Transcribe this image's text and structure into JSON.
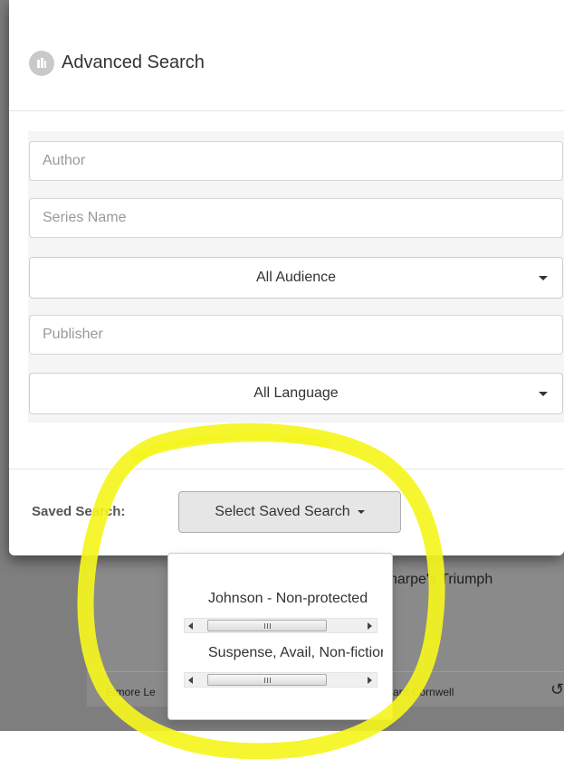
{
  "background": {
    "card_title_fragment": "harpe's Triumph",
    "author_left_fragment": "Elmore Le",
    "author_right_fragment": "ard Cornwell",
    "share_icon": "share-icon"
  },
  "modal": {
    "title": "Advanced Search",
    "logo_icon": "library-logo-icon",
    "fields": {
      "author_placeholder": "Author",
      "series_placeholder": "Series Name",
      "audience_selected": "All Audience",
      "publisher_placeholder": "Publisher",
      "language_selected": "All Language"
    },
    "footer": {
      "saved_search_label": "Saved Search:",
      "saved_search_button": "Select Saved Search"
    }
  },
  "dropdown": {
    "items": [
      {
        "label": "Johnson - Non-protected"
      },
      {
        "label": "Suspense, Avail, Non-fiction"
      }
    ],
    "scroll_glyph": "III"
  },
  "colors": {
    "highlight": "#f5f51e",
    "backdrop": "#7e7e7e"
  }
}
